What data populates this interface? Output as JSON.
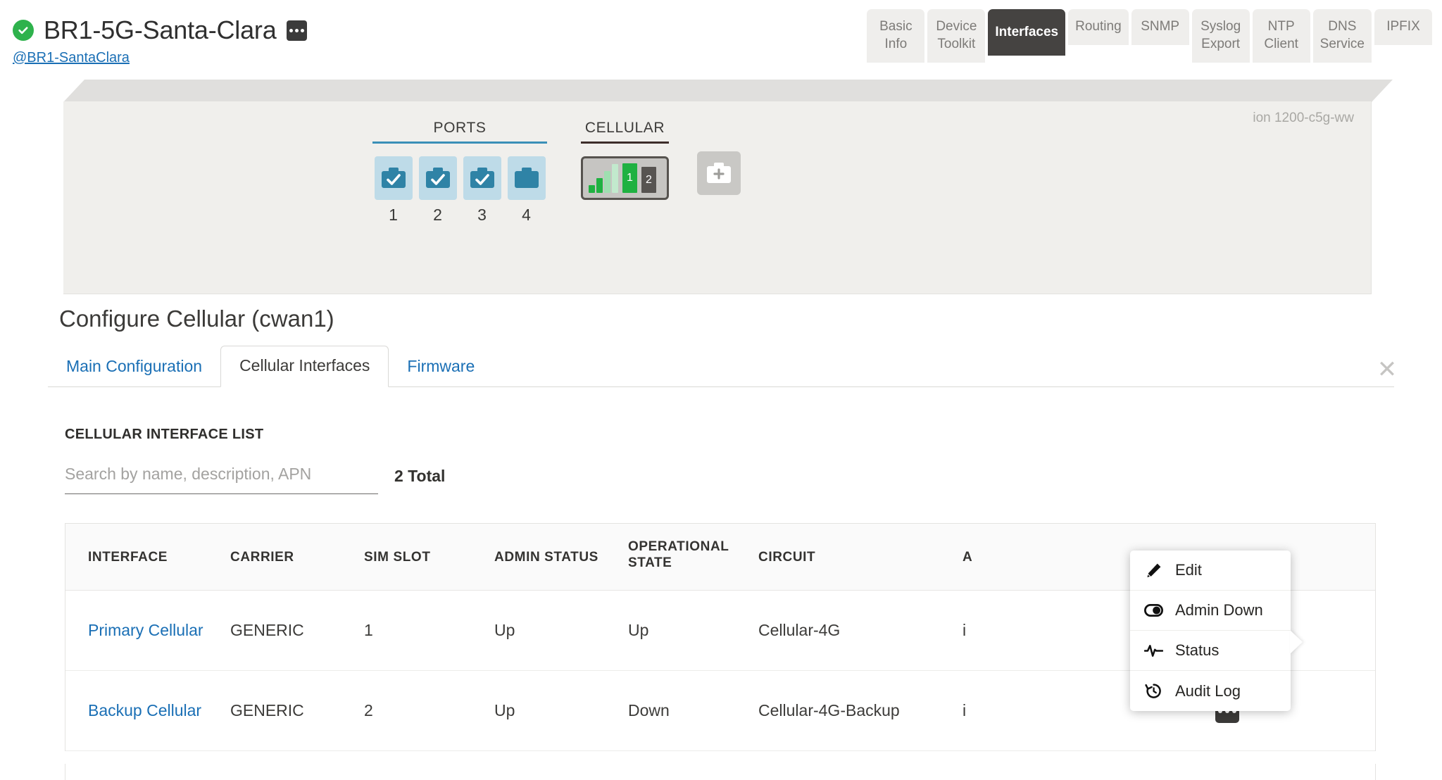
{
  "header": {
    "status_icon": "check-circle-icon",
    "device_name": "BR1-5G-Santa-Clara",
    "device_link": "@BR1-SantaClara",
    "kebab_icon": "more-options-icon",
    "tabs": [
      {
        "label": "Basic\nInfo",
        "active": false
      },
      {
        "label": "Device\nToolkit",
        "active": false
      },
      {
        "label": "Interfaces",
        "active": true
      },
      {
        "label": "Routing",
        "active": false
      },
      {
        "label": "SNMP",
        "active": false
      },
      {
        "label": "Syslog\nExport",
        "active": false
      },
      {
        "label": "NTP\nClient",
        "active": false
      },
      {
        "label": "DNS\nService",
        "active": false
      },
      {
        "label": "IPFIX",
        "active": false
      }
    ]
  },
  "chassis": {
    "model": "ion 1200-c5g-ww",
    "ports_label": "PORTS",
    "cellular_label": "CELLULAR",
    "ports": [
      {
        "number": "1",
        "checked": true
      },
      {
        "number": "2",
        "checked": true
      },
      {
        "number": "3",
        "checked": true
      },
      {
        "number": "4",
        "checked": false
      }
    ],
    "cellular_module": {
      "sim_1_label": "1",
      "sim_2_label": "2",
      "sim_1_active": true,
      "sim_2_active": false,
      "signal_bars": 4,
      "signal_active_bars": 2
    },
    "add_module_icon": "add-module-icon"
  },
  "panel": {
    "title": "Configure Cellular (cwan1)",
    "tabs": [
      {
        "label": "Main Configuration",
        "active": false
      },
      {
        "label": "Cellular Interfaces",
        "active": true
      },
      {
        "label": "Firmware",
        "active": false
      }
    ],
    "close_icon": "close-icon",
    "close_glyph": "✕"
  },
  "list": {
    "heading": "CELLULAR INTERFACE LIST",
    "search_placeholder": "Search by name, description, APN",
    "search_value": "",
    "total": "2 Total",
    "columns": [
      "INTERFACE",
      "CARRIER",
      "SIM SLOT",
      "ADMIN STATUS",
      "OPERATIONAL\nSTATE",
      "CIRCUIT",
      "A"
    ],
    "rows": [
      {
        "interface": "Primary Cellular",
        "carrier": "GENERIC",
        "sim_slot": "1",
        "admin_status": "Up",
        "operational_state": "Up",
        "circuit": "Cellular-4G",
        "apn": "i",
        "action_icon": "more-options-icon"
      },
      {
        "interface": "Backup Cellular",
        "carrier": "GENERIC",
        "sim_slot": "2",
        "admin_status": "Up",
        "operational_state": "Down",
        "circuit": "Cellular-4G-Backup",
        "apn": "i",
        "action_icon": "more-options-icon"
      }
    ]
  },
  "context_menu": {
    "items": [
      {
        "label": "Edit",
        "icon": "pencil-icon"
      },
      {
        "label": "Admin Down",
        "icon": "toggle-icon"
      },
      {
        "label": "Status",
        "icon": "activity-pulse-icon"
      },
      {
        "label": "Audit Log",
        "icon": "history-clock-icon"
      }
    ]
  },
  "colors": {
    "accent_blue": "#1a6fb5",
    "status_green": "#2eb24c",
    "active_tab_dark": "#454341",
    "port_teal": "#2f83a6",
    "ports_rule": "#3a8fb7"
  }
}
